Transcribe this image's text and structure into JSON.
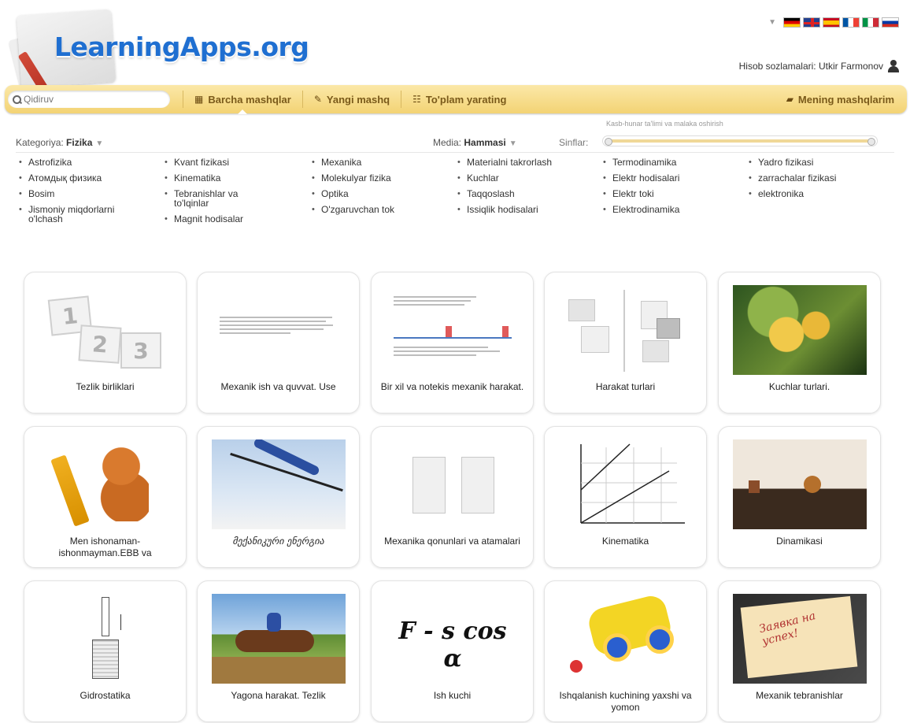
{
  "header": {
    "logo_text": "LearningApps.org",
    "account_label": "Hisob sozlamalari: Utkir Farmonov",
    "languages": [
      "de",
      "gb",
      "es",
      "fr",
      "it",
      "ru"
    ]
  },
  "toolbar": {
    "search_placeholder": "Qidiruv",
    "all_exercises": "Barcha mashqlar",
    "new_exercise": "Yangi mashq",
    "create_collection": "To'plam yarating",
    "my_exercises": "Mening mashqlarim",
    "icons": {
      "all_exercises": "grid-icon",
      "new_exercise": "pencil-icon",
      "create_collection": "collection-icon",
      "my_exercises": "folder-icon"
    },
    "accent_color": "#f3d374"
  },
  "filters": {
    "category_label": "Kategoriya:",
    "category_value": "Fizika",
    "media_label": "Media:",
    "media_value": "Hammasi",
    "grade_label": "Sinflar:",
    "range_label": "Kasb-hunar ta'limi va malaka oshirish"
  },
  "categories": [
    [
      "Astrofizika",
      "Атомдық физика",
      "Bosim",
      "Jismoniy miqdorlarni o'lchash"
    ],
    [
      "Kvant fizikasi",
      "Kinematika",
      "Tebranishlar va to'lqinlar",
      "Magnit hodisalar"
    ],
    [
      "Mexanika",
      "Molekulyar fizika",
      "Optika",
      "O'zgaruvchan tok"
    ],
    [
      "Materialni takrorlash",
      "Kuchlar",
      "Taqqoslash",
      "Issiqlik hodisalari"
    ],
    [
      "Termodinamika",
      "Elektr hodisalari",
      "Elektr toki",
      "Elektrodinamika"
    ],
    [
      "Yadro fizikasi",
      "zarrachalar fizikasi",
      "elektronika"
    ]
  ],
  "cards": [
    {
      "title": "Tezlik birliklari",
      "thumb": "numbers"
    },
    {
      "title": "Mexanik ish va quvvat. Use",
      "thumb": "text-doc"
    },
    {
      "title": "Bir xil va notekis mexanik harakat.",
      "thumb": "text-diagram"
    },
    {
      "title": "Harakat turlari",
      "thumb": "pairs"
    },
    {
      "title": "Kuchlar turlari.",
      "thumb": "flower-photo"
    },
    {
      "title": "Men ishonaman-ishonmayman.EBB va",
      "thumb": "squirrel"
    },
    {
      "title": "მექანიკური ენერგია",
      "thumb": "ski-photo"
    },
    {
      "title": "Mexanika qonunlari va atamalari",
      "thumb": "media-pairs"
    },
    {
      "title": "Kinematika",
      "thumb": "graph"
    },
    {
      "title": "Dinamikasi",
      "thumb": "still-life-photo"
    },
    {
      "title": "Gidrostatika",
      "thumb": "hydro"
    },
    {
      "title": "Yagona harakat. Tezlik",
      "thumb": "horse-photo"
    },
    {
      "title": "Ish kuchi",
      "thumb": "formula"
    },
    {
      "title": "Ishqalanish kuchining yaxshi va yomon",
      "thumb": "toy-car"
    },
    {
      "title": "Mexanik tebranishlar",
      "thumb": "note-photo"
    }
  ],
  "formula_text": "F - s cos α",
  "note_text": "Заявка на успех!"
}
